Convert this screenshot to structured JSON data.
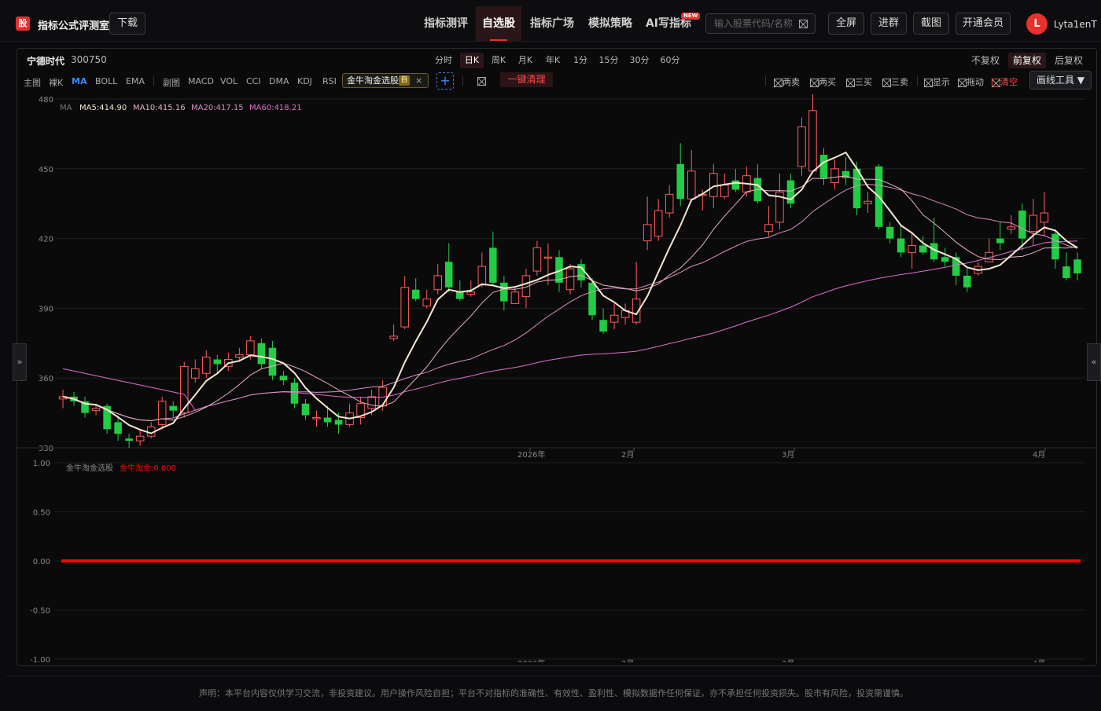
{
  "app": {
    "logo_text": "股",
    "brand": "指标公式评测室",
    "download": "下载"
  },
  "nav": [
    {
      "label": "指标测评",
      "active": false
    },
    {
      "label": "自选股",
      "active": true
    },
    {
      "label": "指标广场",
      "active": false
    },
    {
      "label": "模拟策略",
      "active": false
    },
    {
      "label": "AI写指标",
      "active": false,
      "badge": "NEW"
    }
  ],
  "search": {
    "placeholder": "输入股票代码/名称"
  },
  "header_buttons": {
    "fullscreen": "全屏",
    "join_group": "进群",
    "screenshot": "截图",
    "vip": "开通会员"
  },
  "user": {
    "avatar": "L",
    "name": "Lyta1enT"
  },
  "stock": {
    "name": "宁德时代",
    "code": "300750"
  },
  "periods": [
    {
      "label": "分时",
      "active": false
    },
    {
      "label": "日K",
      "active": true
    },
    {
      "label": "周K",
      "active": false
    },
    {
      "label": "月K",
      "active": false
    },
    {
      "label": "年K",
      "active": false
    },
    {
      "label": "1分",
      "active": false
    },
    {
      "label": "15分",
      "active": false
    },
    {
      "label": "30分",
      "active": false
    },
    {
      "label": "60分",
      "active": false
    }
  ],
  "adjust": [
    {
      "label": "不复权",
      "active": false
    },
    {
      "label": "前复权",
      "active": true
    },
    {
      "label": "后复权",
      "active": false
    }
  ],
  "indicators": {
    "main_label": "主图",
    "main": [
      {
        "label": "裸K",
        "active": false
      },
      {
        "label": "MA",
        "active": true
      },
      {
        "label": "BOLL",
        "active": false
      },
      {
        "label": "EMA",
        "active": false
      }
    ],
    "sub_label": "副图",
    "sub": [
      "MACD",
      "VOL",
      "CCI",
      "DMA",
      "KDJ",
      "RSI"
    ],
    "custom_chip": "金牛淘金选股",
    "custom_tag": "自",
    "clear_all": "一键清理"
  },
  "tools": [
    {
      "label": "两卖",
      "red": false
    },
    {
      "label": "两买",
      "red": false
    },
    {
      "label": "三买",
      "red": false
    },
    {
      "label": "三卖",
      "red": false
    },
    {
      "label": "显示",
      "red": false
    },
    {
      "label": "拖动",
      "red": false
    },
    {
      "label": "清空",
      "red": true
    }
  ],
  "draw_tool": "画线工具",
  "side_buttons": {
    "left": "»",
    "right": "«"
  },
  "colors": {
    "up": "#ff5a5a",
    "down": "#22cc44",
    "ma5": "#f5e6d0",
    "ma10": "#e8b0c0",
    "ma20": "#d890c0",
    "ma60": "#e070c8",
    "signal": "#ff0000"
  },
  "chart_data": [
    {
      "type": "candlestick",
      "title": "宁德时代 300750 日K",
      "ylim": [
        330,
        480
      ],
      "yticks": [
        330,
        360,
        390,
        420,
        450,
        480
      ],
      "x_markers": [
        "2026年",
        "2月",
        "3月",
        "4月"
      ],
      "ma_legend": {
        "name": "MA",
        "items": [
          {
            "label": "MA5:414.90",
            "key": "ma5"
          },
          {
            "label": "MA10:415.16",
            "key": "ma10"
          },
          {
            "label": "MA20:417.15",
            "key": "ma20"
          },
          {
            "label": "MA60:418.21",
            "key": "ma60"
          }
        ]
      },
      "candles": [
        [
          351,
          352,
          355,
          347
        ],
        [
          352,
          350,
          354,
          348
        ],
        [
          350,
          345,
          352,
          343
        ],
        [
          346,
          347,
          349,
          344
        ],
        [
          348,
          338,
          349,
          336
        ],
        [
          341,
          336,
          344,
          333
        ],
        [
          334,
          333,
          336,
          330
        ],
        [
          333,
          335,
          338,
          331
        ],
        [
          335,
          339,
          341,
          334
        ],
        [
          340,
          350,
          352,
          338
        ],
        [
          348,
          346,
          350,
          343
        ],
        [
          345,
          365,
          367,
          343
        ],
        [
          360,
          364,
          368,
          358
        ],
        [
          362,
          369,
          372,
          360
        ],
        [
          368,
          366,
          370,
          362
        ],
        [
          365,
          368,
          371,
          363
        ],
        [
          369,
          370,
          373,
          367
        ],
        [
          370,
          376,
          378,
          368
        ],
        [
          375,
          366,
          377,
          364
        ],
        [
          373,
          361,
          376,
          359
        ],
        [
          361,
          359,
          363,
          357
        ],
        [
          358,
          349,
          360,
          347
        ],
        [
          349,
          344,
          351,
          342
        ],
        [
          343,
          343,
          346,
          339
        ],
        [
          343,
          341,
          348,
          339
        ],
        [
          342,
          340,
          345,
          336
        ],
        [
          340,
          345,
          349,
          339
        ],
        [
          343,
          349,
          352,
          340
        ],
        [
          347,
          352,
          355,
          344
        ],
        [
          348,
          356,
          359,
          346
        ],
        [
          377,
          378,
          383,
          376
        ],
        [
          382,
          399,
          404,
          381
        ],
        [
          398,
          394,
          403,
          393
        ],
        [
          391,
          394,
          398,
          390
        ],
        [
          398,
          404,
          409,
          396
        ],
        [
          410,
          399,
          418,
          397
        ],
        [
          397,
          394,
          402,
          393
        ],
        [
          396,
          397,
          402,
          395
        ],
        [
          400,
          408,
          414,
          399
        ],
        [
          416,
          401,
          423,
          400
        ],
        [
          401,
          393,
          404,
          389
        ],
        [
          392,
          397,
          399,
          395
        ],
        [
          395,
          404,
          407,
          390
        ],
        [
          406,
          416,
          419,
          404
        ],
        [
          412,
          412,
          418,
          400
        ],
        [
          412,
          401,
          415,
          397
        ],
        [
          398,
          407,
          409,
          396
        ],
        [
          409,
          402,
          411,
          399
        ],
        [
          401,
          387,
          403,
          385
        ],
        [
          385,
          380,
          390,
          379
        ],
        [
          384,
          387,
          392,
          381
        ],
        [
          386,
          389,
          392,
          383
        ],
        [
          384,
          394,
          410,
          383
        ],
        [
          419,
          426,
          438,
          415
        ],
        [
          421,
          432,
          437,
          419
        ],
        [
          431,
          439,
          443,
          429
        ],
        [
          452,
          437,
          461,
          434
        ],
        [
          437,
          449,
          458,
          436
        ],
        [
          439,
          439,
          441,
          432
        ],
        [
          438,
          448,
          452,
          433
        ],
        [
          438,
          443,
          448,
          437
        ],
        [
          445,
          441,
          450,
          440
        ],
        [
          440,
          447,
          451,
          438
        ],
        [
          446,
          436,
          452,
          435
        ],
        [
          423,
          426,
          434,
          421
        ],
        [
          427,
          440,
          448,
          424
        ],
        [
          445,
          435,
          448,
          433
        ],
        [
          451,
          468,
          472,
          447
        ],
        [
          449,
          475,
          482,
          448
        ],
        [
          456,
          446,
          459,
          443
        ],
        [
          444,
          450,
          454,
          441
        ],
        [
          449,
          446,
          455,
          443
        ],
        [
          450,
          433,
          453,
          430
        ],
        [
          435,
          436,
          440,
          431
        ],
        [
          451,
          425,
          452,
          424
        ],
        [
          425,
          420,
          427,
          418
        ],
        [
          420,
          414,
          426,
          412
        ],
        [
          414,
          417,
          423,
          407
        ],
        [
          417,
          414,
          421,
          413
        ],
        [
          418,
          411,
          429,
          410
        ],
        [
          412,
          410,
          416,
          408
        ],
        [
          412,
          404,
          414,
          400
        ],
        [
          404,
          399,
          408,
          397
        ],
        [
          405,
          408,
          410,
          404
        ],
        [
          410,
          414,
          420,
          411
        ],
        [
          420,
          418,
          427,
          415
        ],
        [
          424,
          425,
          430,
          422
        ],
        [
          432,
          420,
          435,
          415
        ],
        [
          423,
          430,
          437,
          417
        ],
        [
          427,
          431,
          440,
          421
        ],
        [
          422,
          411,
          424,
          407
        ],
        [
          408,
          403,
          414,
          402
        ],
        [
          411,
          405,
          414,
          402
        ]
      ]
    },
    {
      "type": "line",
      "title": "金牛淘金选股",
      "legend": [
        {
          "label": "金牛淘金选股",
          "key": "name"
        },
        {
          "label": "金牛淘金:0.000",
          "key": "value"
        }
      ],
      "ylim": [
        -1.0,
        1.0
      ],
      "yticks": [
        "1.00",
        "0.50",
        "0.00",
        "-0.50",
        "-1.00"
      ],
      "x_markers": [
        "2026年",
        "2月",
        "3月",
        "4月"
      ],
      "series": [
        {
          "name": "金牛淘金",
          "value": 0.0
        }
      ]
    }
  ],
  "footer": "声明：本平台内容仅供学习交流，非投资建议。用户操作风险自担；平台不对指标的准确性、有效性、盈利性、模拟数据作任何保证，亦不承担任何投资损失。股市有风险，投资需谨慎。"
}
